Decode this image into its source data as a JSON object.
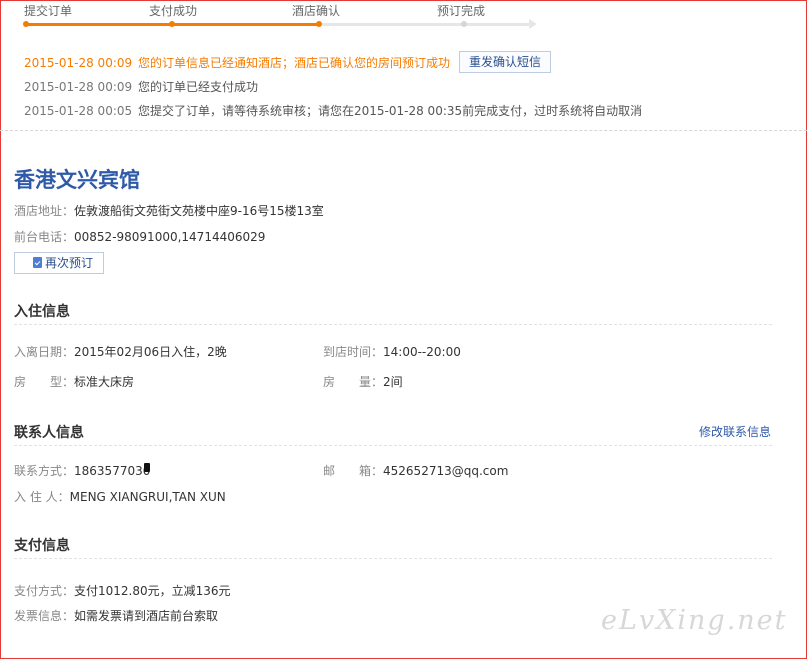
{
  "progress": {
    "steps": [
      {
        "label": "提交订单",
        "done": true
      },
      {
        "label": "支付成功",
        "done": true
      },
      {
        "label": "酒店确认",
        "done": true
      },
      {
        "label": "预订完成",
        "done": false
      }
    ]
  },
  "log": [
    {
      "time": "2015-01-28 00:09",
      "message": "您的订单信息已经通知酒店；酒店已确认您的房间预订成功",
      "highlight": true
    },
    {
      "time": "2015-01-28 00:09",
      "message": "您的订单已经支付成功",
      "highlight": false
    },
    {
      "time": "2015-01-28 00:05",
      "message": "您提交了订单，请等待系统审核；请您在2015-01-28 00:35前完成支付，过时系统将自动取消",
      "highlight": false
    }
  ],
  "resend_button": "重发确认短信",
  "hotel": {
    "name": "香港文兴宾馆",
    "address_label": "酒店地址：",
    "address": "佐敦渡船街文苑街文苑楼中座9-16号15楼13室",
    "phone_label": "前台电话：",
    "phone": "00852-98091000,14714406029",
    "rebook_label": "再次预订"
  },
  "checkin": {
    "title": "入住信息",
    "dates_label": "入离日期：",
    "dates": "2015年02月06日入住，2晚",
    "arrival_label": "到店时间：",
    "arrival": "14:00--20:00",
    "room_type_label": "房　　型：",
    "room_type": "标准大床房",
    "room_count_label": "房　　量：",
    "room_count": "2间"
  },
  "contact": {
    "title": "联系人信息",
    "edit_link": "修改联系信息",
    "phone_label": "联系方式：",
    "phone": "1863577030",
    "email_label": "邮　　箱：",
    "email": "452652713@qq.com",
    "guests_label": "入 住 人：",
    "guests": "MENG XIANGRUI,TAN XUN"
  },
  "payment": {
    "title": "支付信息",
    "method_label": "支付方式：",
    "method": "支付1012.80元，立减136元",
    "invoice_label": "发票信息：",
    "invoice": "如需发票请到酒店前台索取"
  },
  "watermark": "eLvXing.net",
  "colors": {
    "accent": "#f57c00",
    "link": "#2e5aa8",
    "frame": "#e53935"
  }
}
